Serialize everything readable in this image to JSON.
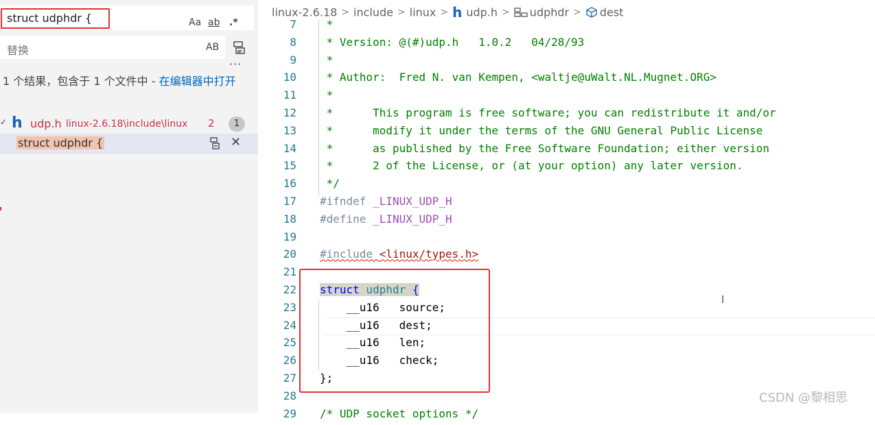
{
  "sidebar": {
    "search_value": "struct udphdr {",
    "options": {
      "match_case": "Aa",
      "whole_word": "ab",
      "regex": ".*"
    },
    "replace_placeholder": "替换",
    "replace_preserve_case": "AB",
    "more": "···",
    "result_summary": "1 个结果，包含于 1 个文件中 - ",
    "open_in_editor": "在编辑器中打开",
    "file": {
      "name": "udp.h",
      "path": "linux-2.6.18\\include\\linux",
      "count": "2",
      "badge": "1"
    },
    "match_text": "struct udphdr {",
    "close_glyph": "✕"
  },
  "breadcrumb": {
    "items": [
      "linux-2.6.18",
      "include",
      "linux",
      "udp.h",
      "udphdr",
      "dest"
    ],
    "separator": ">",
    "file_icon_glyph": "h"
  },
  "code_lines": [
    {
      "n": "7",
      "text": " *"
    },
    {
      "n": "8",
      "text": " * Version: @(#)udp.h   1.0.2   04/28/93"
    },
    {
      "n": "9",
      "text": " *"
    },
    {
      "n": "10",
      "text": " * Author:  Fred N. van Kempen, <waltje@uWalt.NL.Mugnet.ORG>"
    },
    {
      "n": "11",
      "text": " *"
    },
    {
      "n": "12",
      "text": " *      This program is free software; you can redistribute it and/or"
    },
    {
      "n": "13",
      "text": " *      modify it under the terms of the GNU General Public License"
    },
    {
      "n": "14",
      "text": " *      as published by the Free Software Foundation; either version"
    },
    {
      "n": "15",
      "text": " *      2 of the License, or (at your option) any later version."
    },
    {
      "n": "16",
      "text": " */"
    },
    {
      "n": "17",
      "pp": "#ifndef ",
      "mac": "_LINUX_UDP_H"
    },
    {
      "n": "18",
      "pp": "#define ",
      "mac": "_LINUX_UDP_H"
    },
    {
      "n": "19",
      "text": ""
    },
    {
      "n": "20",
      "pp": "#include ",
      "str": "<linux/types.h>"
    },
    {
      "n": "21",
      "text": ""
    },
    {
      "n": "22",
      "kw": "struct",
      "tname": " udphdr",
      "punct": " {"
    },
    {
      "n": "23",
      "text": "    __u16   source;"
    },
    {
      "n": "24",
      "text": "    __u16   dest;"
    },
    {
      "n": "25",
      "text": "    __u16   len;"
    },
    {
      "n": "26",
      "text": "    __u16   check;"
    },
    {
      "n": "27",
      "text": "};"
    },
    {
      "n": "28",
      "text": ""
    },
    {
      "n": "29",
      "text": "/* UDP socket options */"
    }
  ],
  "watermark": "CSDN @黎相思",
  "colors": {
    "highlight_red": "#e03131",
    "comment": "#008000",
    "keyword": "#0000ff",
    "type": "#267f99",
    "line_number": "#237893"
  }
}
